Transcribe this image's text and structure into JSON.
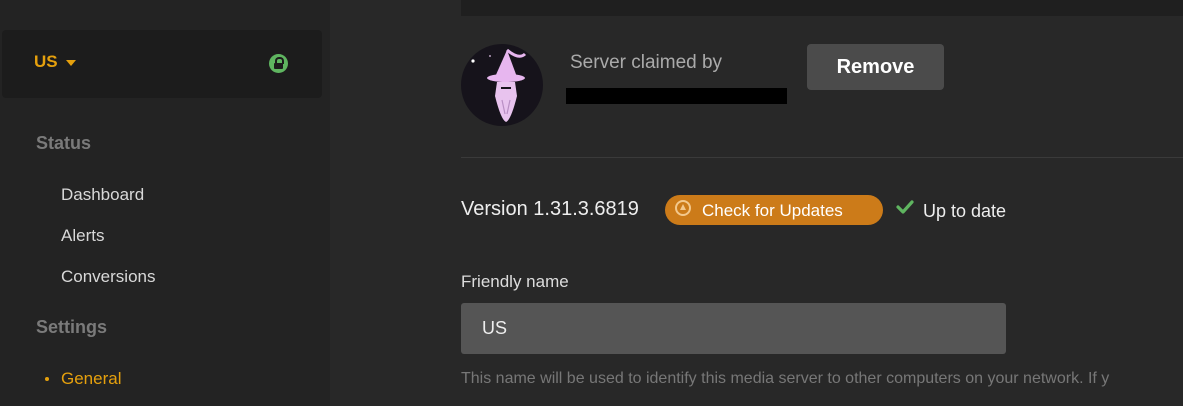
{
  "sidebar": {
    "server_name": "US",
    "sections": {
      "status": "Status",
      "settings": "Settings"
    },
    "status_items": [
      "Dashboard",
      "Alerts",
      "Conversions"
    ],
    "settings_items": [
      "General"
    ],
    "active_item": "General"
  },
  "claim": {
    "label": "Server claimed by",
    "remove_label": "Remove"
  },
  "version": {
    "text": "Version 1.31.3.6819",
    "check_updates_label": "Check for Updates",
    "status_text": "Up to date"
  },
  "friendly_name": {
    "label": "Friendly name",
    "value": "US",
    "help": "This name will be used to identify this media server to other computers on your network. If y"
  },
  "colors": {
    "accent": "#e5a00d",
    "update_button": "#cc7b19",
    "ok_green": "#5fb560",
    "lock_green": "#5fb560"
  },
  "icons": {
    "server_dropdown": "chevron-down-icon",
    "secure": "lock-icon",
    "update": "upload-circle-icon",
    "status_ok": "checkmark-icon",
    "avatar": "wizard-avatar"
  }
}
